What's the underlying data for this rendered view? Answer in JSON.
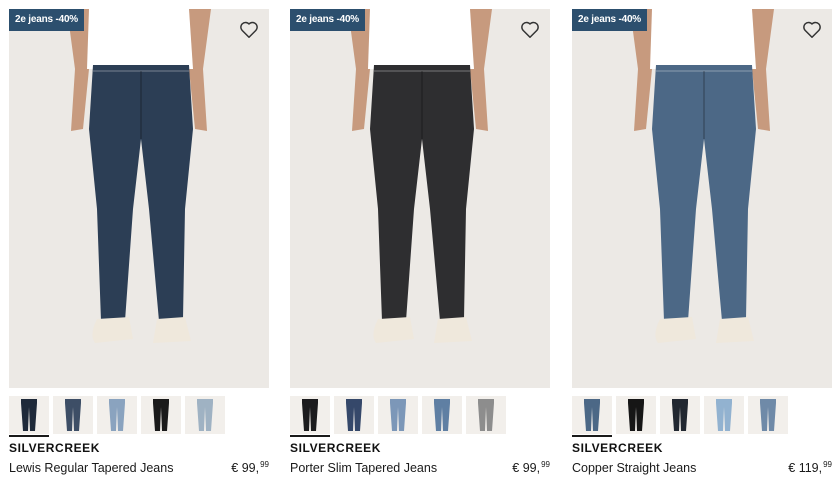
{
  "products": [
    {
      "promo": "2e jeans -40%",
      "brand": "SILVERCREEK",
      "name": "Lewis Regular Tapered Jeans",
      "currency": "€",
      "price_main": "99,",
      "price_cents": "99",
      "jeans_color": "#2c3e55",
      "swatch_colors": [
        "#1f2a3a",
        "#3d4e66",
        "#8aa3bf",
        "#1a1a1a",
        "#9fb2c3"
      ],
      "active_swatch": 0,
      "wishlist_icon": "heart-outline-icon"
    },
    {
      "promo": "2e jeans -40%",
      "brand": "SILVERCREEK",
      "name": "Porter Slim Tapered Jeans",
      "currency": "€",
      "price_main": "99,",
      "price_cents": "99",
      "jeans_color": "#2e2e30",
      "swatch_colors": [
        "#1c1c1e",
        "#35486a",
        "#7c97b8",
        "#5f7fa3",
        "#8d8d8d"
      ],
      "active_swatch": 0,
      "wishlist_icon": "heart-outline-icon"
    },
    {
      "promo": "2e jeans -40%",
      "brand": "SILVERCREEK",
      "name": "Copper Straight Jeans",
      "currency": "€",
      "price_main": "119,",
      "price_cents": "99",
      "jeans_color": "#4c6886",
      "swatch_colors": [
        "#4c6886",
        "#161616",
        "#222831",
        "#92b2d0",
        "#6f8aa8"
      ],
      "active_swatch": 0,
      "wishlist_icon": "heart-outline-icon"
    }
  ],
  "colors": {
    "promo_bg": "#2c4f6e",
    "photo_bg": "#ece9e5",
    "shirt": "#ffffff",
    "skin": "#c79a7e",
    "sneaker": "#efe8dc"
  }
}
